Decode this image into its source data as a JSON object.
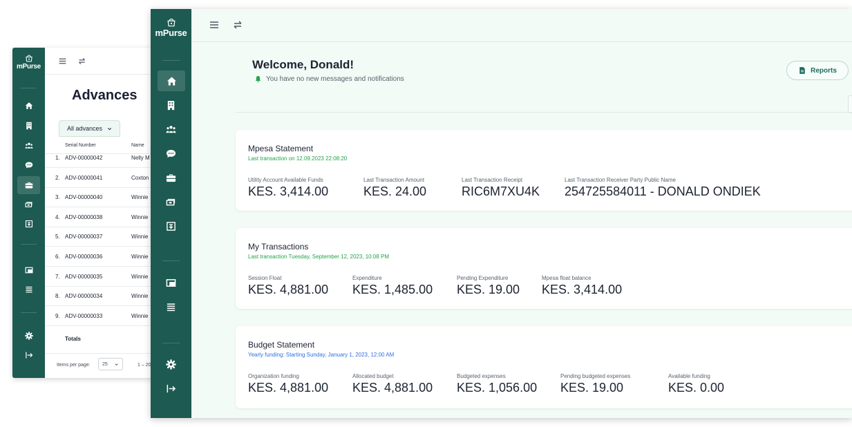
{
  "brand": {
    "name": "mPurse"
  },
  "colors": {
    "sidebar": "#1d5a51",
    "page_bg": "#f2fbf6",
    "accent_green": "#24a348",
    "accent_blue": "#2f6fe0",
    "accent_teal": "#1d6b5d"
  },
  "back_window": {
    "title": "Advances",
    "filter_chip": "All advances",
    "table": {
      "headers": [
        "Serial Number",
        "Name"
      ],
      "rows": [
        {
          "index": "1.",
          "serial": "ADV-00000042",
          "name": "Nelly M"
        },
        {
          "index": "2.",
          "serial": "ADV-00000041",
          "name": "Coxton"
        },
        {
          "index": "3.",
          "serial": "ADV-00000040",
          "name": "Winnie"
        },
        {
          "index": "4.",
          "serial": "ADV-00000038",
          "name": "Winnie"
        },
        {
          "index": "5.",
          "serial": "ADV-00000037",
          "name": "Winnie"
        },
        {
          "index": "6.",
          "serial": "ADV-00000036",
          "name": "Winnie"
        },
        {
          "index": "7.",
          "serial": "ADV-00000035",
          "name": "Winnie"
        },
        {
          "index": "8.",
          "serial": "ADV-00000034",
          "name": "Winnie"
        },
        {
          "index": "9.",
          "serial": "ADV-00000033",
          "name": "Winnie"
        }
      ],
      "totals_label": "Totals"
    },
    "paginator": {
      "items_per_page_label": "Items per page:",
      "items_per_page_value": "25",
      "range_label": "1 – 20"
    }
  },
  "front_window": {
    "welcome": {
      "title": "Welcome, Donald!",
      "notifications": "You have no new messages and notifications"
    },
    "reports_button": "Reports",
    "cards": [
      {
        "title": "Mpesa Statement",
        "subtitle": "Last transaction on 12.09.2023 22:08:20",
        "stats": [
          {
            "label": "Utility Account Available Funds",
            "value": "KES. 3,414.00"
          },
          {
            "label": "Last Transaction Amount",
            "value": "KES. 24.00"
          },
          {
            "label": "Last Transaction Receipt",
            "value": "RIC6M7XU4K"
          },
          {
            "label": "Last Transaction Receiver Party Public Name",
            "value": "254725584011 - DONALD ONDIEK"
          }
        ]
      },
      {
        "title": "My Transactions",
        "subtitle": "Last transaction Tuesday, September 12, 2023, 10:08 PM",
        "stats": [
          {
            "label": "Session Float",
            "value": "KES. 4,881.00"
          },
          {
            "label": "Expenditure",
            "value": "KES. 1,485.00"
          },
          {
            "label": "Pending Expenditure",
            "value": "KES. 19.00"
          },
          {
            "label": "Mpesa float balance",
            "value": "KES. 3,414.00"
          }
        ]
      },
      {
        "title": "Budget Statement",
        "subtitle": "Yearly funding: Starting Sunday, January 1, 2023, 12:00 AM",
        "stats": [
          {
            "label": "Organization funding",
            "value": "KES. 4,881.00"
          },
          {
            "label": "Allocated budget",
            "value": "KES. 4,881.00"
          },
          {
            "label": "Budgeted expenses",
            "value": "KES. 1,056.00"
          },
          {
            "label": "Pending budgeted expenses",
            "value": "KES. 19.00"
          },
          {
            "label": "Available funding",
            "value": "KES. 0.00"
          }
        ]
      }
    ]
  },
  "icons": {
    "sidebar": [
      "home-icon",
      "building-icon",
      "team-icon",
      "chat-icon",
      "briefcase-icon",
      "cash-icon",
      "receipt-icon",
      "cards-icon",
      "list-icon",
      "settings-icon",
      "logout-icon"
    ],
    "topbar": [
      "menu-icon",
      "swap-icon"
    ]
  }
}
